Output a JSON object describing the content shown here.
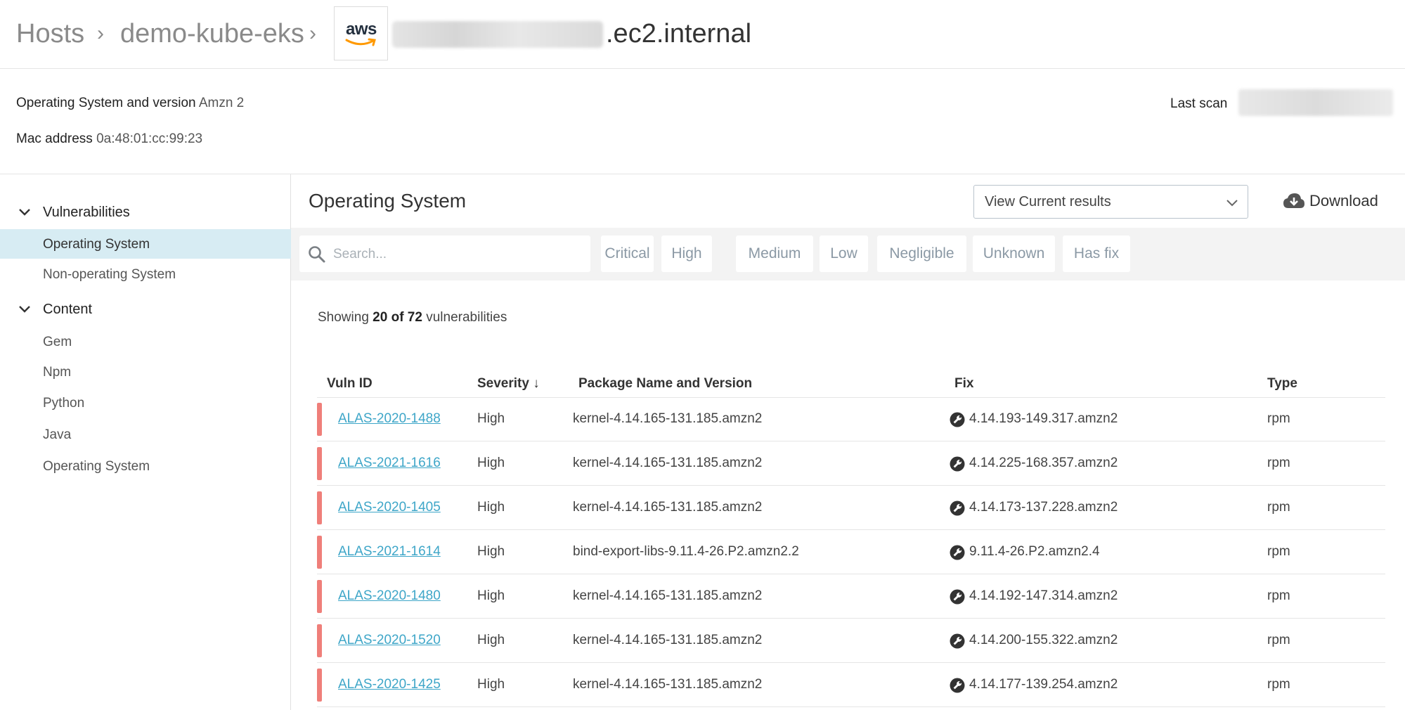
{
  "breadcrumb": {
    "hosts": "Hosts",
    "cluster": "demo-kube-eks",
    "provider_logo": "aws",
    "host_suffix": ".ec2.internal"
  },
  "info": {
    "os_label": "Operating System and version",
    "os_value": "Amzn 2",
    "mac_label": "Mac address",
    "mac_value": "0a:48:01:cc:99:23",
    "last_scan_label": "Last scan"
  },
  "sidebar": {
    "groups": [
      {
        "label": "Vulnerabilities",
        "items": [
          "Operating System",
          "Non-operating System"
        ]
      },
      {
        "label": "Content",
        "items": [
          "Gem",
          "Npm",
          "Python",
          "Java",
          "Operating System"
        ]
      }
    ],
    "active_item": "Operating System"
  },
  "main": {
    "title": "Operating System",
    "view_select": "View Current results",
    "download_label": "Download",
    "search_placeholder": "Search...",
    "filters": [
      "Critical",
      "High",
      "Medium",
      "Low",
      "Negligible",
      "Unknown",
      "Has fix"
    ],
    "showing_prefix": "Showing",
    "showing_count": "20 of 72",
    "showing_suffix": "vulnerabilities"
  },
  "table": {
    "columns": [
      "Vuln ID",
      "Severity ↓",
      "Package Name and Version",
      "Fix",
      "Type"
    ],
    "rows": [
      {
        "id": "ALAS-2020-1488",
        "severity": "High",
        "package": "kernel-4.14.165-131.185.amzn2",
        "fix": "4.14.193-149.317.amzn2",
        "type": "rpm"
      },
      {
        "id": "ALAS-2021-1616",
        "severity": "High",
        "package": "kernel-4.14.165-131.185.amzn2",
        "fix": "4.14.225-168.357.amzn2",
        "type": "rpm"
      },
      {
        "id": "ALAS-2020-1405",
        "severity": "High",
        "package": "kernel-4.14.165-131.185.amzn2",
        "fix": "4.14.173-137.228.amzn2",
        "type": "rpm"
      },
      {
        "id": "ALAS-2021-1614",
        "severity": "High",
        "package": "bind-export-libs-9.11.4-26.P2.amzn2.2",
        "fix": "9.11.4-26.P2.amzn2.4",
        "type": "rpm"
      },
      {
        "id": "ALAS-2020-1480",
        "severity": "High",
        "package": "kernel-4.14.165-131.185.amzn2",
        "fix": "4.14.192-147.314.amzn2",
        "type": "rpm"
      },
      {
        "id": "ALAS-2020-1520",
        "severity": "High",
        "package": "kernel-4.14.165-131.185.amzn2",
        "fix": "4.14.200-155.322.amzn2",
        "type": "rpm"
      },
      {
        "id": "ALAS-2020-1425",
        "severity": "High",
        "package": "kernel-4.14.165-131.185.amzn2",
        "fix": "4.14.177-139.254.amzn2",
        "type": "rpm"
      }
    ]
  },
  "colors": {
    "severity_high": "#ef7f7a",
    "link": "#3ea6c8",
    "active_nav": "#d7ecf3"
  },
  "icons": {
    "group_toggle": "chevron-down-icon",
    "select": "chevron-down-icon",
    "download": "cloud-download-icon",
    "search": "search-icon",
    "fix": "wrench-icon"
  }
}
